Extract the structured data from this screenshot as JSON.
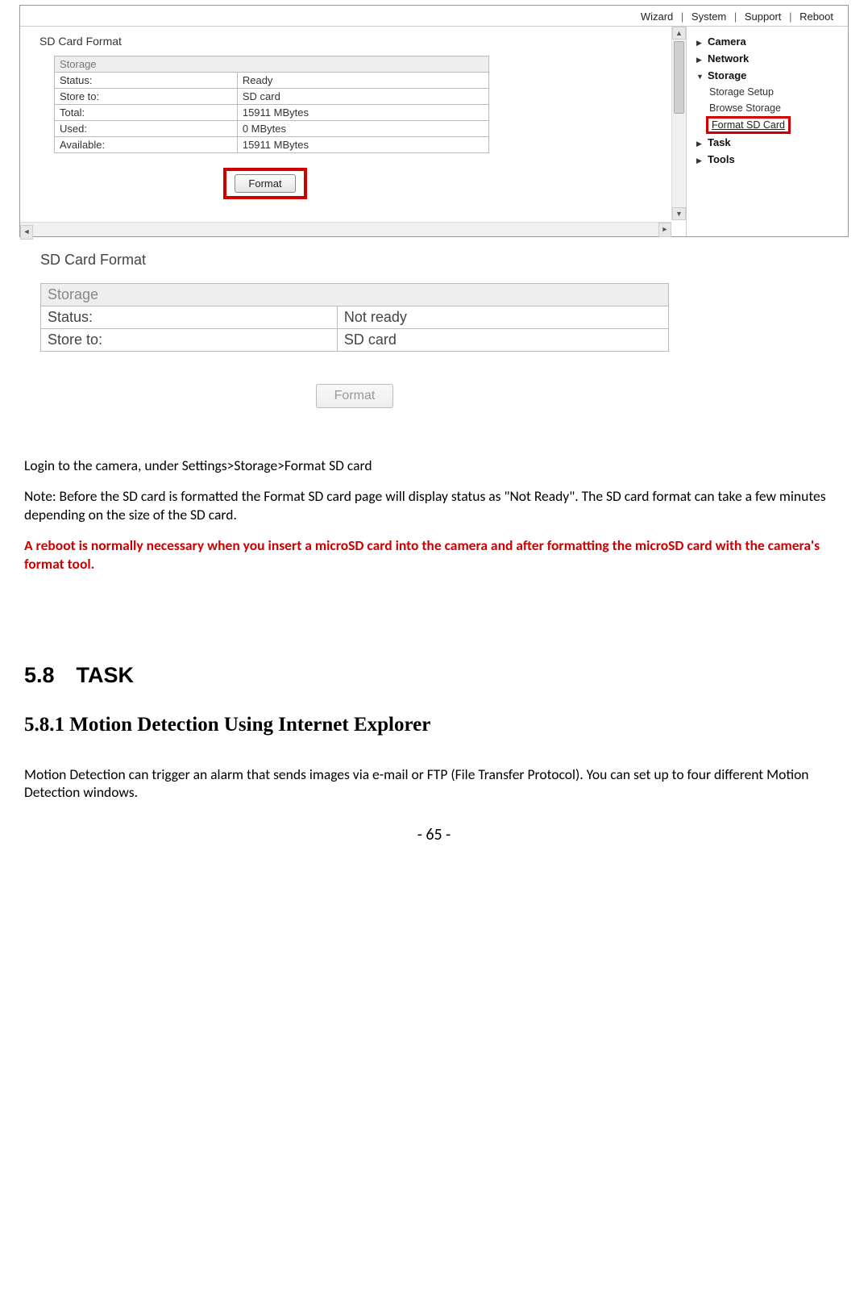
{
  "topnav": {
    "wizard": "Wizard",
    "system": "System",
    "support": "Support",
    "reboot": "Reboot"
  },
  "shot1": {
    "title": "SD Card Format",
    "table": {
      "header": "Storage",
      "rows": [
        {
          "k": "Status:",
          "v": "Ready"
        },
        {
          "k": "Store to:",
          "v": "SD card"
        },
        {
          "k": "Total:",
          "v": "15911 MBytes"
        },
        {
          "k": "Used:",
          "v": "0 MBytes"
        },
        {
          "k": "Available:",
          "v": "15911 MBytes"
        }
      ]
    },
    "format_btn": "Format"
  },
  "tree": {
    "camera": "Camera",
    "network": "Network",
    "storage": "Storage",
    "storage_setup": "Storage Setup",
    "browse_storage": "Browse Storage",
    "format_sd": "Format SD Card",
    "task": "Task",
    "tools": "Tools"
  },
  "shot2": {
    "title": "SD Card Format",
    "table": {
      "header": "Storage",
      "rows": [
        {
          "k": "Status:",
          "v": "Not ready"
        },
        {
          "k": "Store to:",
          "v": "SD card"
        }
      ]
    },
    "format_btn": "Format"
  },
  "doc": {
    "p1": "Login to the camera, under Settings>Storage>Format SD card",
    "p2": "Note: Before the SD card is formatted the Format SD card page will display status as \"Not Ready\". The SD card format can take a few minutes depending on the size of the SD card.",
    "p3": "A reboot is normally necessary when you insert a microSD card into the camera and after formatting the microSD card with the camera's format tool.",
    "h2": "5.8 TASK",
    "h3": "5.8.1 Motion Detection Using Internet Explorer",
    "p4": "Motion Detection can trigger an alarm that sends images via e-mail or FTP (File Transfer Protocol). You can set up to four different Motion Detection windows.",
    "pagenum": "- 65 -"
  }
}
